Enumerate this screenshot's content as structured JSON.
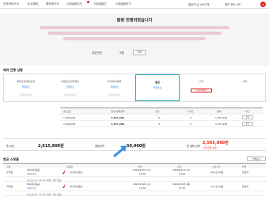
{
  "nav": {
    "items": [
      "전체카테고리",
      "국내/해외",
      "해외패키지",
      "스페셜패키지",
      "스페셜할인",
      "스페셜찜하기"
    ],
    "right": [
      "챌린지 님 VIP고객",
      "예약 관리 VIP"
    ]
  },
  "banner": {
    "title": "발권 진행되었습니다",
    "code_label": "일련번호",
    "code_value": "2명",
    "code_button": "인쇄"
  },
  "progress": {
    "section_title": "예약 진행 상황",
    "steps": [
      {
        "label": "예약요청/결제요청",
        "sub": "결제완료",
        "date": "2023/03/14"
      },
      {
        "label": "여권정보입력/확인",
        "sub": "입력완료",
        "date": "2023/03/14"
      },
      {
        "label": "좌석배정/결제",
        "sub": "결제완료",
        "date": "2023/03/14"
      },
      {
        "label": "발권",
        "sub": "발권완료",
        "date": "",
        "active": true
      },
      {
        "label": "출국",
        "sub": "",
        "date": "",
        "button": "여행일정확인"
      },
      {
        "label": "귀국",
        "sub": "",
        "date": ""
      }
    ]
  },
  "fare_table": {
    "headers": [
      "총 요금",
      "항공 결제금액",
      "할인",
      "수수료",
      "총액",
      "비고"
    ],
    "rows": [
      [
        "1,300,000",
        "1,257,900",
        "0",
        "0",
        "1,257,900",
        "보기"
      ],
      [
        "1,300,000",
        "1,257,900",
        "0",
        "0",
        "1,257,900",
        "보기"
      ]
    ]
  },
  "totals": {
    "price_label": "총 요금",
    "price_value": "2,615,800원",
    "paid_label": "결제금액",
    "paid_value": "50,000원",
    "discount_label": "할인금액",
    "final_label": "총 결제 금액",
    "final_value": "2,565,800원",
    "final_note": "(할인금액 포함)"
  },
  "flights": {
    "section_title": "항공 스케줄",
    "headers": [
      "구분",
      "항공편",
      "출발",
      "도착",
      "소요시간",
      "좌석"
    ],
    "rows": [
      {
        "type": "출국편",
        "flight": "아시아나항공",
        "code": "OZ0202",
        "dep": "2023/03/15 (수)",
        "dep_time": "10:30",
        "arr": "2023/03/15 (수)",
        "arr_time": "14:10",
        "dur": "09시간 00분",
        "seat": "일반석",
        "note": "총 소요시간: 09시간 00분 / 경유 없음"
      },
      {
        "type": "귀국편",
        "flight": "아시아나항공",
        "code": "OZ0201",
        "dep": "2023/03/22 (수)",
        "dep_time": "11:30",
        "arr": "2023/03/23 (목)",
        "arr_time": "17:10",
        "dur": "11시간 00분",
        "seat": "일반석",
        "note": "총 소요시간: 11시간 00분 / 경유 없음"
      }
    ],
    "filter": "전체보기"
  }
}
